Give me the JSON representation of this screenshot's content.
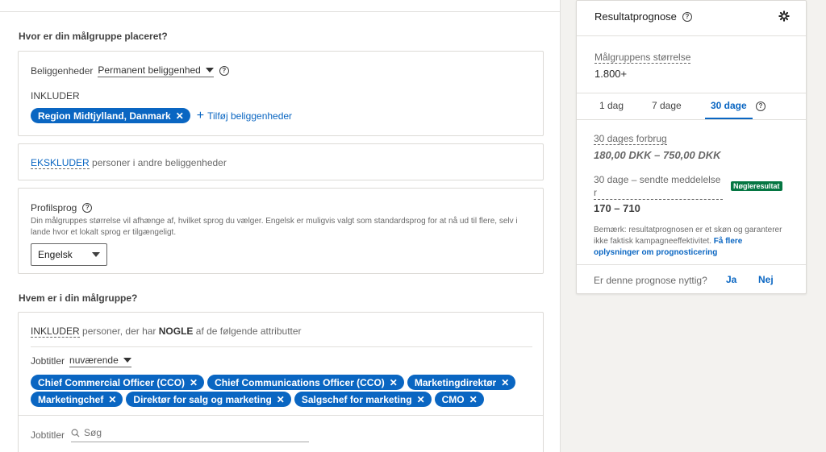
{
  "location": {
    "section_title": "Hvor er din målgruppe placeret?",
    "label": "Beliggenheder",
    "dropdown_value": "Permanent beliggenhed",
    "include_label": "INKLUDER",
    "pills": [
      "Region Midtjylland, Danmark"
    ],
    "add_link": "Tilføj beliggenheder"
  },
  "exclude": {
    "link": "EKSKLUDER",
    "text": "personer i andre beliggenheder"
  },
  "profile_language": {
    "title": "Profilsprog",
    "description": "Din målgruppes størrelse vil afhænge af, hvilket sprog du vælger. Engelsk er muligvis valgt som standardsprog for at nå ud til flere, selv i lande hvor et lokalt sprog er tilgængeligt.",
    "selected": "Engelsk"
  },
  "audience": {
    "section_title": "Hvem er i din målgruppe?",
    "include_link": "INKLUDER",
    "include_text_1": "personer, der har",
    "include_bold": "NOGLE",
    "include_text_2": "af de følgende attributter",
    "jobtitles_label": "Jobtitler",
    "jobtitles_dropdown": "nuværende",
    "pills_row1": [
      "Chief Commercial Officer (CCO)",
      "Chief Communications Officer (CCO)",
      "Marketingdirektør"
    ],
    "pills_row2": [
      "Marketingchef",
      "Direktør for salg og marketing",
      "Salgschef for marketing",
      "CMO"
    ],
    "search_label": "Jobtitler",
    "search_placeholder": "Søg"
  },
  "forecast": {
    "title": "Resultatprognose",
    "audience_size_label": "Målgruppens størrelse",
    "audience_size_value": "1.800+",
    "tabs": [
      "1 dag",
      "7 dage",
      "30 dage"
    ],
    "active_tab": "30 dage",
    "spend_label": "30 dages forbrug",
    "spend_value": "180,00 DKK – 750,00 DKK",
    "messages_label_1": "30 dage – sendte meddelelse",
    "messages_label_2": "r",
    "key_badge": "Nøgleresultat",
    "messages_value": "170 – 710",
    "disclaimer": "Bemærk: resultatprognosen er et skøn og garanterer ikke faktisk kampagneeffektivitet.",
    "disclaimer_link": "Få flere oplysninger om prognosticering",
    "feedback_question": "Er denne prognose nyttig?",
    "yes": "Ja",
    "no": "Nej"
  },
  "colors": {
    "accent": "#0a66c2",
    "badge": "#057642",
    "background": "#f3f2ef"
  }
}
